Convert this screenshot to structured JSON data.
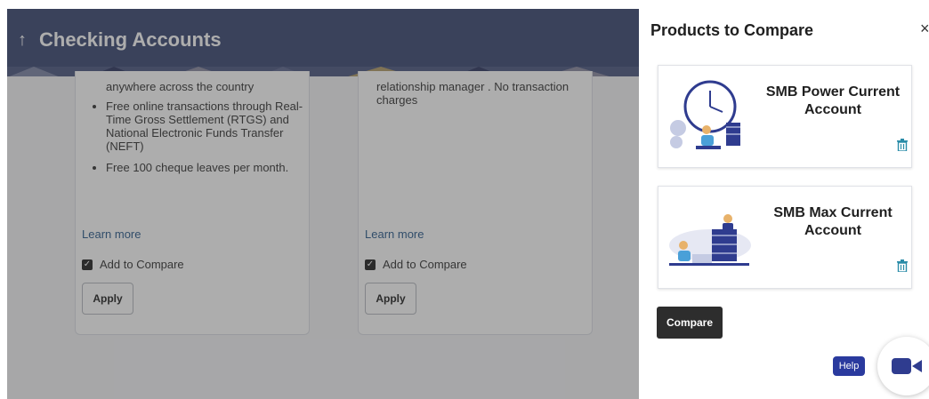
{
  "header": {
    "title": "Checking Accounts",
    "back_icon": "up-arrow-icon"
  },
  "cards": [
    {
      "lead": "anywhere across the country",
      "bullets": [
        "Free online transactions through Real-Time Gross Settlement (RTGS) and National Electronic Funds Transfer (NEFT)",
        "Free 100 cheque leaves per month."
      ],
      "learn_more": "Learn more",
      "compare_label": "Add to Compare",
      "compare_checked": true,
      "apply_label": "Apply"
    },
    {
      "lead": "relationship manager . No transaction charges",
      "bullets": [],
      "learn_more": "Learn more",
      "compare_label": "Add to Compare",
      "compare_checked": true,
      "apply_label": "Apply"
    }
  ],
  "panel": {
    "title": "Products to Compare",
    "close_label": "×",
    "products": [
      {
        "name": "SMB Power Current Account",
        "image": "clock-coins-illustration"
      },
      {
        "name": "SMB Max Current Account",
        "image": "coin-stack-illustration"
      }
    ],
    "compare_label": "Compare"
  },
  "help_label": "Help",
  "colors": {
    "header_bg": "#3a4873",
    "link": "#2a5a8c",
    "trash_icon": "#2a8ca8",
    "help_bg": "#2a3a9e",
    "video_icon": "#2f3c8f"
  }
}
